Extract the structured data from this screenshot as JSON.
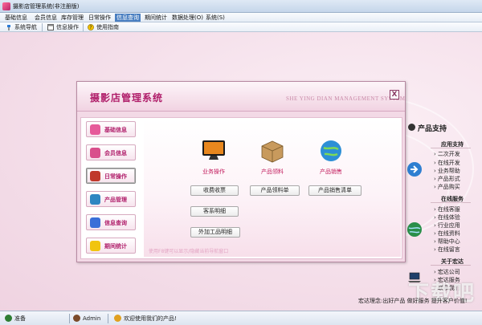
{
  "window": {
    "title": "摄影店管理系统(非注册版)"
  },
  "menu": {
    "items": [
      {
        "label": "基础信息"
      },
      {
        "label": "会员信息"
      },
      {
        "label": "库存管理"
      },
      {
        "label": "日常操作"
      },
      {
        "label": "信息查询"
      },
      {
        "label": "期间统计"
      },
      {
        "label": "数据处理(O)"
      },
      {
        "label": "系统(S)"
      }
    ],
    "active_index": 4
  },
  "toolbar": {
    "items": [
      {
        "label": "系统导航",
        "icon": "pin-icon"
      },
      {
        "label": "信息操作",
        "icon": "window-icon"
      },
      {
        "label": "使用指南",
        "icon": "help-icon"
      }
    ]
  },
  "dialog": {
    "title": "摄影店管理系统",
    "subtitle": "SHE YING DIAN MANAGEMENT SYSTEM",
    "close_label": "X",
    "nav": [
      {
        "label": "基础信息",
        "icon": "gear-icon",
        "color": "#e65a9a"
      },
      {
        "label": "会员信息",
        "icon": "members-icon",
        "color": "#d94f8c"
      },
      {
        "label": "日常操作",
        "icon": "clipboard-icon",
        "color": "#c0392b"
      },
      {
        "label": "产品管理",
        "icon": "monitor-icon",
        "color": "#2e86c1"
      },
      {
        "label": "信息查询",
        "icon": "search-icon",
        "color": "#3a6fd8"
      },
      {
        "label": "期间统计",
        "icon": "star-icon",
        "color": "#f1c40f"
      }
    ],
    "active_nav_index": 2,
    "categories": [
      {
        "label": "业务操作",
        "icon": "monitor-icon"
      },
      {
        "label": "产品领料",
        "icon": "box-icon"
      },
      {
        "label": "产品销售",
        "icon": "globe-icon"
      }
    ],
    "buttons": {
      "receipt": "收费收票",
      "material_list": "产品领料单",
      "sales_list": "产品销售清单",
      "customer_detail": "客系明细",
      "outsource_detail": "外加工品明细"
    },
    "hint": "使用F8键可以显示/隐藏当前导航窗口"
  },
  "side_panel": {
    "title": "产品支持",
    "sections": [
      {
        "heading": "应用支持",
        "items": [
          "二次开发",
          "在线开发",
          "业务帮助",
          "产品形式",
          "产品购买"
        ]
      },
      {
        "heading": "在线服务",
        "items": [
          "在线客服",
          "在线体验",
          "行业应用",
          "在线资料",
          "帮助中心",
          "在线留言"
        ]
      },
      {
        "heading": "关于宏达",
        "items": [
          "宏达公司",
          "宏达服务",
          "联系我们"
        ]
      }
    ],
    "slogan": "宏达理念:出好产品  做好服务  提升客户价值!",
    "watermark": "下载吧"
  },
  "status": {
    "ready": "准备",
    "user": "Admin",
    "welcome": "欢迎使用我们的产品!"
  },
  "colors": {
    "accent": "#b01e6a",
    "menu_active": "#4a7fc1",
    "dialog_bg": "#f3d9e6"
  }
}
